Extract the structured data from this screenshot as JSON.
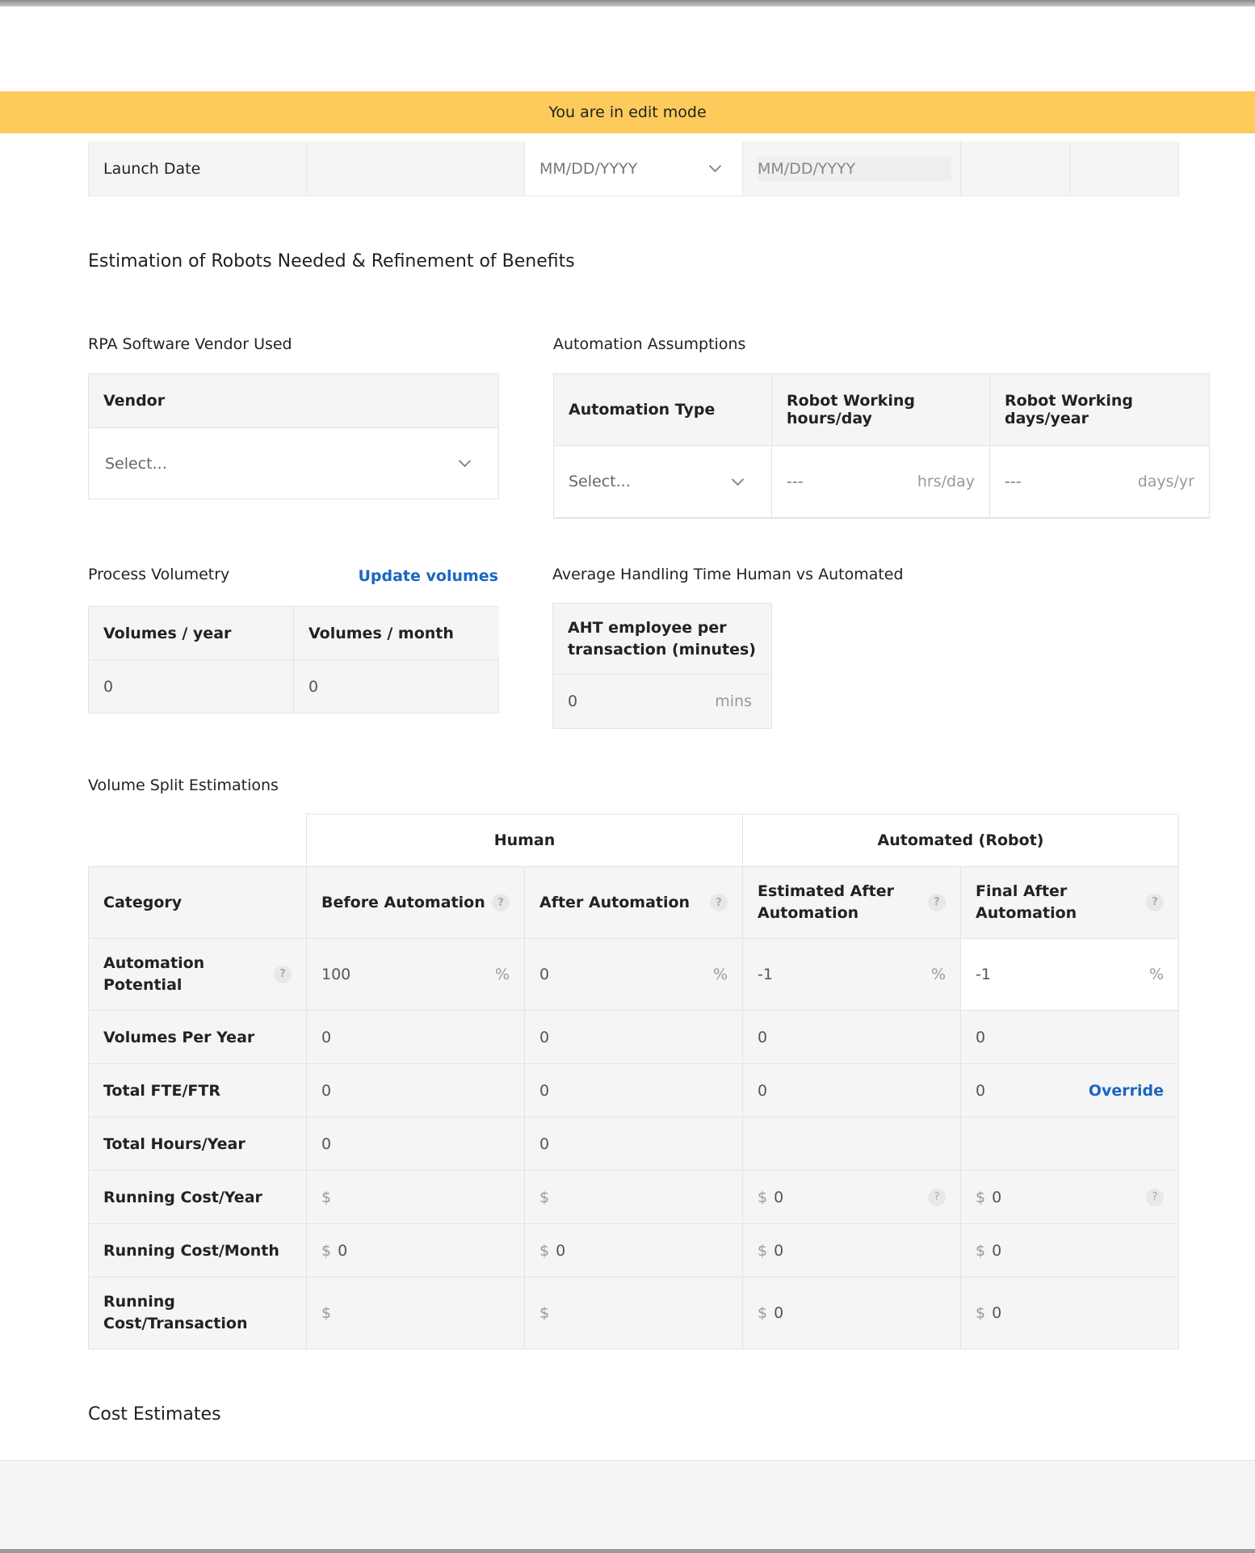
{
  "banner": {
    "text": "You are in edit mode"
  },
  "launch": {
    "label": "Launch Date",
    "date1_placeholder": "MM/DD/YYYY",
    "date2_placeholder": "MM/DD/YYYY"
  },
  "section_title": "Estimation of Robots Needed & Refinement of Benefits",
  "vendor": {
    "title": "RPA Software Vendor Used",
    "header": "Vendor",
    "select_placeholder": "Select..."
  },
  "assumptions": {
    "title": "Automation Assumptions",
    "headers": [
      "Automation Type",
      "Robot Working hours/day",
      "Robot Working days/year"
    ],
    "type_placeholder": "Select...",
    "hours_value": "---",
    "hours_unit": "hrs/day",
    "days_value": "---",
    "days_unit": "days/yr"
  },
  "volumetry": {
    "title": "Process Volumetry",
    "update_link": "Update volumes",
    "headers": [
      "Volumes / year",
      "Volumes / month"
    ],
    "values": [
      "0",
      "0"
    ]
  },
  "aht": {
    "title": "Average Handling Time Human vs Automated",
    "header": "AHT employee per transaction (minutes)",
    "value": "0",
    "unit": "mins"
  },
  "volume_split": {
    "title": "Volume Split Estimations",
    "groups": [
      "Human",
      "Automated (Robot)"
    ],
    "headers": [
      "Category",
      "Before Automation",
      "After Automation",
      "Estimated After Automation",
      "Final After Automation"
    ],
    "help": "?",
    "percent": "%",
    "dollar": "$",
    "override_label": "Override",
    "rows": [
      {
        "label": "Automation Potential",
        "values": [
          "100",
          "0",
          "-1",
          "-1"
        ]
      },
      {
        "label": "Volumes Per Year",
        "values": [
          "0",
          "0",
          "0",
          "0"
        ]
      },
      {
        "label": "Total FTE/FTR",
        "values": [
          "0",
          "0",
          "0",
          "0"
        ]
      },
      {
        "label": "Total Hours/Year",
        "values": [
          "0",
          "0",
          "",
          ""
        ]
      },
      {
        "label": "Running Cost/Year",
        "values": [
          "",
          "",
          "0",
          "0"
        ]
      },
      {
        "label": "Running Cost/Month",
        "values": [
          "0",
          "0",
          "0",
          "0"
        ]
      },
      {
        "label": "Running Cost/Transaction",
        "values": [
          "",
          "",
          "0",
          "0"
        ]
      }
    ]
  },
  "cost_estimates_title": "Cost Estimates"
}
